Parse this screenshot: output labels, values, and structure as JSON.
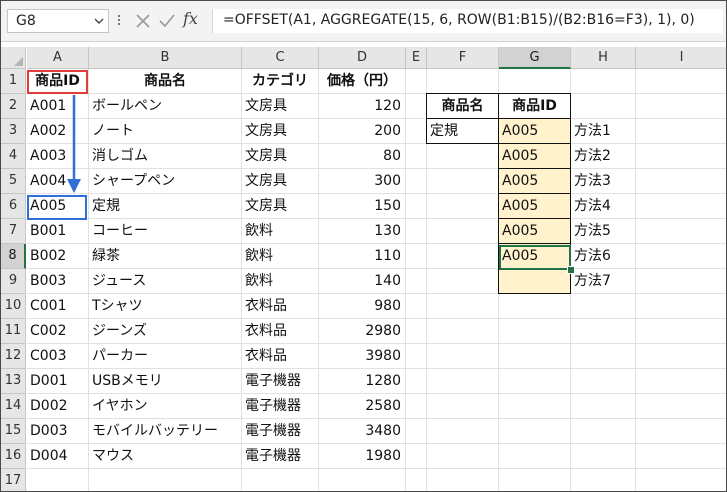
{
  "formula_bar": {
    "name_box": "G8",
    "fx_label": "fx",
    "formula": "=OFFSET(A1, AGGREGATE(15, 6, ROW(B1:B15)/(B2:B16=F3), 1), 0)"
  },
  "columns": [
    "A",
    "B",
    "C",
    "D",
    "E",
    "F",
    "G",
    "H",
    "I"
  ],
  "rows": [
    "1",
    "2",
    "3",
    "4",
    "5",
    "6",
    "7",
    "8",
    "9",
    "10",
    "11",
    "12",
    "13",
    "14",
    "15",
    "16",
    "17"
  ],
  "table": {
    "headers": [
      "商品ID",
      "商品名",
      "カテゴリ",
      "価格（円）"
    ],
    "rows": [
      [
        "A001",
        "ボールペン",
        "文房具",
        "120"
      ],
      [
        "A002",
        "ノート",
        "文房具",
        "200"
      ],
      [
        "A003",
        "消しゴム",
        "文房具",
        "80"
      ],
      [
        "A004",
        "シャープペン",
        "文房具",
        "300"
      ],
      [
        "A005",
        "定規",
        "文房具",
        "150"
      ],
      [
        "B001",
        "コーヒー",
        "飲料",
        "130"
      ],
      [
        "B002",
        "緑茶",
        "飲料",
        "110"
      ],
      [
        "B003",
        "ジュース",
        "飲料",
        "140"
      ],
      [
        "C001",
        "Tシャツ",
        "衣料品",
        "980"
      ],
      [
        "C002",
        "ジーンズ",
        "衣料品",
        "2980"
      ],
      [
        "C003",
        "パーカー",
        "衣料品",
        "3980"
      ],
      [
        "D001",
        "USBメモリ",
        "電子機器",
        "1280"
      ],
      [
        "D002",
        "イヤホン",
        "電子機器",
        "2580"
      ],
      [
        "D003",
        "モバイルバッテリー",
        "電子機器",
        "3480"
      ],
      [
        "D004",
        "マウス",
        "電子機器",
        "1980"
      ]
    ]
  },
  "lookup": {
    "header_name": "商品名",
    "header_id": "商品ID",
    "name_value": "定規",
    "results": [
      "A005",
      "A005",
      "A005",
      "A005",
      "A005",
      "A005",
      ""
    ],
    "methods": [
      "方法1",
      "方法2",
      "方法3",
      "方法4",
      "方法5",
      "方法6",
      "方法7"
    ]
  },
  "colors": {
    "highlight_fill": "#fff2cc",
    "red_box": "#e03c3c",
    "blue_box": "#2f6fd6",
    "selection_green": "#217346"
  }
}
